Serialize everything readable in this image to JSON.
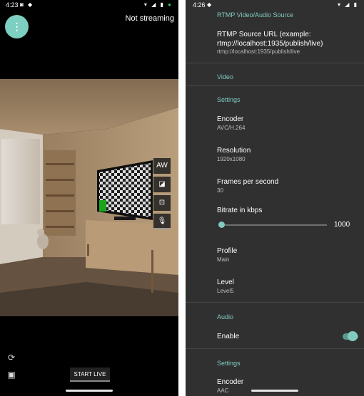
{
  "left_phone": {
    "status_time": "4:23",
    "status_icons_left": "◙ ◆",
    "status_icons_right": "▾ ◢ ▮",
    "stream_status": "Not streaming",
    "menu_fab_glyph": "⋮",
    "side_controls": {
      "auto_white": "AW",
      "exposure": "◪",
      "focus": "⊡",
      "mic": "🎙"
    },
    "bottom": {
      "switch_camera_glyph": "⟳",
      "camera_glyph": "▣",
      "start_live_label": "START LIVE"
    }
  },
  "right_phone": {
    "status_time": "4:26",
    "status_icons_left": "◆",
    "status_icons_right": "▾ ◢ ▮",
    "sections": {
      "rtmp_header": "RTMP Video/Audio Source",
      "rtmp_source_title": "RTMP Source URL (example: rtmp://localhost:1935/publish/live)",
      "rtmp_source_value": "rtmp://localhost:1935/publish/live",
      "video_header": "Video",
      "video_settings_header": "Settings",
      "encoder_title": "Encoder",
      "encoder_value": "AVC/H.264",
      "resolution_title": "Resolution",
      "resolution_value": "1920x1080",
      "fps_title": "Frames per second",
      "fps_value": "30",
      "bitrate_title": "Bitrate in kbps",
      "bitrate_value": "1000",
      "bitrate_slider_fraction": 0.0,
      "profile_title": "Profile",
      "profile_value": "Main",
      "level_title": "Level",
      "level_value": "Level5",
      "audio_header": "Audio",
      "audio_enable_title": "Enable",
      "audio_enabled": true,
      "audio_settings_header": "Settings",
      "audio_encoder_title": "Encoder",
      "audio_encoder_value": "AAC"
    }
  },
  "colors": {
    "accent": "#81cbc0",
    "fab": "#7ccfc1",
    "settings_bg": "#303030",
    "preview_bg": "#000000"
  }
}
